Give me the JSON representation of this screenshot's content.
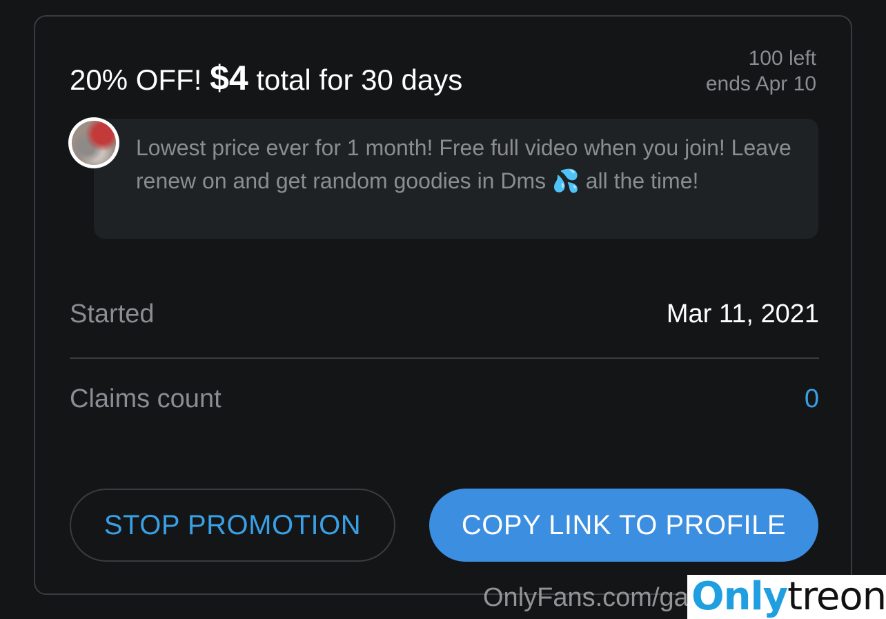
{
  "promotion": {
    "title_prefix": "20% OFF!",
    "price": "$4",
    "title_suffix": "total for 30 days",
    "remaining": "100 left",
    "ends": "ends Apr 10",
    "message": "Lowest price ever for 1 month! Free full video when you join! Leave renew on and get random goodies in Dms 💦 all the time!"
  },
  "stats": {
    "started_label": "Started",
    "started_value": "Mar 11, 2021",
    "claims_label": "Claims count",
    "claims_value": "0"
  },
  "actions": {
    "stop_label": "STOP PROMOTION",
    "copy_label": "COPY LINK TO PROFILE"
  },
  "watermark": {
    "url_text": "OnlyFans.com/ga",
    "brand_part1": "Only",
    "brand_part2": "treon"
  },
  "colors": {
    "accent": "#3b8ee0",
    "accent_text": "#3aa0e6",
    "background": "#141517"
  }
}
